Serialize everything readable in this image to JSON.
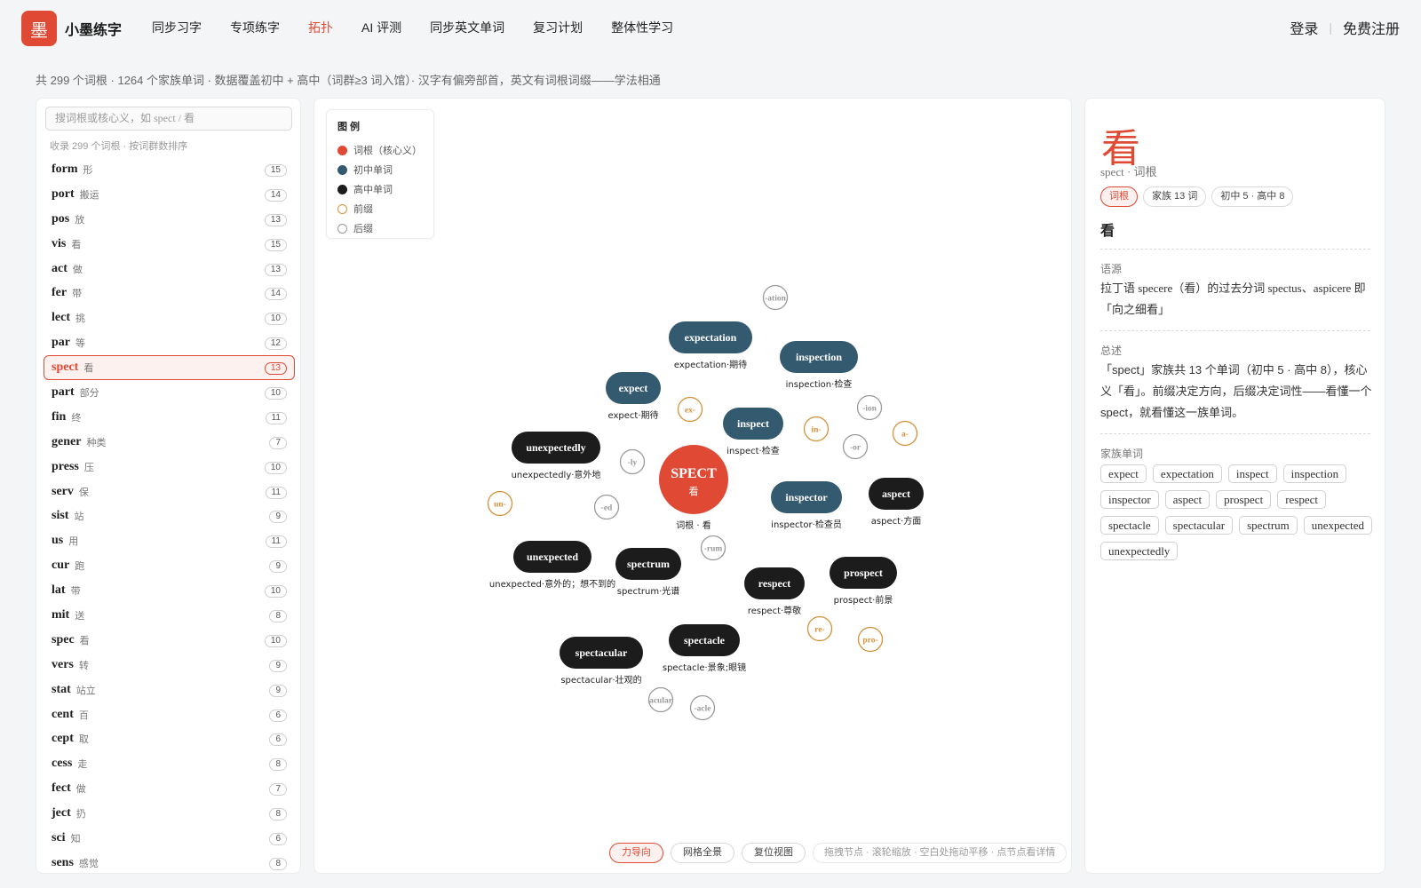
{
  "header": {
    "logo_char": "墨",
    "brand": "小墨练字",
    "nav": [
      "同步习字",
      "专项练字",
      "拓扑",
      "AI 评测",
      "同步英文单词",
      "复习计划",
      "整体性学习"
    ],
    "active_nav": "拓扑",
    "login": "登录",
    "separator": "|",
    "register": "免费注册"
  },
  "subline": "共 299 个词根 · 1264 个家族单词 · 数据覆盖初中 + 高中（词群≥3 词入馆）· 汉字有偏旁部首，英文有词根词缀——学法相通",
  "sidebar": {
    "search_placeholder": "搜词根或核心义，如 spect / 看",
    "count_note": "收录 299 个词根 · 按词群数排序",
    "roots": [
      {
        "name": "form",
        "meaning": "形",
        "count": "15"
      },
      {
        "name": "port",
        "meaning": "搬运",
        "count": "14"
      },
      {
        "name": "pos",
        "meaning": "放",
        "count": "13"
      },
      {
        "name": "vis",
        "meaning": "看",
        "count": "15"
      },
      {
        "name": "act",
        "meaning": "做",
        "count": "13"
      },
      {
        "name": "fer",
        "meaning": "带",
        "count": "14"
      },
      {
        "name": "lect",
        "meaning": "挑",
        "count": "10"
      },
      {
        "name": "par",
        "meaning": "等",
        "count": "12"
      },
      {
        "name": "spect",
        "meaning": "看",
        "count": "13",
        "active": true
      },
      {
        "name": "part",
        "meaning": "部分",
        "count": "10"
      },
      {
        "name": "fin",
        "meaning": "终",
        "count": "11"
      },
      {
        "name": "gener",
        "meaning": "种类",
        "count": "7"
      },
      {
        "name": "press",
        "meaning": "压",
        "count": "10"
      },
      {
        "name": "serv",
        "meaning": "保",
        "count": "11"
      },
      {
        "name": "sist",
        "meaning": "站",
        "count": "9"
      },
      {
        "name": "us",
        "meaning": "用",
        "count": "11"
      },
      {
        "name": "cur",
        "meaning": "跑",
        "count": "9"
      },
      {
        "name": "lat",
        "meaning": "带",
        "count": "10"
      },
      {
        "name": "mit",
        "meaning": "送",
        "count": "8"
      },
      {
        "name": "spec",
        "meaning": "看",
        "count": "10"
      },
      {
        "name": "vers",
        "meaning": "转",
        "count": "9"
      },
      {
        "name": "stat",
        "meaning": "站立",
        "count": "9"
      },
      {
        "name": "cent",
        "meaning": "百",
        "count": "6"
      },
      {
        "name": "cept",
        "meaning": "取",
        "count": "6"
      },
      {
        "name": "cess",
        "meaning": "走",
        "count": "8"
      },
      {
        "name": "fect",
        "meaning": "做",
        "count": "7"
      },
      {
        "name": "ject",
        "meaning": "扔",
        "count": "8"
      },
      {
        "name": "sci",
        "meaning": "知",
        "count": "6"
      },
      {
        "name": "sens",
        "meaning": "感觉",
        "count": "8"
      }
    ]
  },
  "legend": {
    "title": "图 例",
    "items": [
      {
        "label": "词根（核心义）",
        "color": "#e04a35",
        "style": "fill"
      },
      {
        "label": "初中单词",
        "color": "#345a70",
        "style": "fill"
      },
      {
        "label": "高中单词",
        "color": "#1c1c1c",
        "style": "fill"
      },
      {
        "label": "前缀",
        "color": "#d4913a",
        "style": "ring"
      },
      {
        "label": "后缀",
        "color": "#9a9a9a",
        "style": "ring"
      }
    ]
  },
  "graph": {
    "root": {
      "word": "SPECT",
      "meaning": "看",
      "caption": "词根 · 看"
    },
    "words": [
      {
        "word": "expectation",
        "caption": "expectation·期待",
        "level": "middle"
      },
      {
        "word": "inspection",
        "caption": "inspection·检查",
        "level": "middle"
      },
      {
        "word": "expect",
        "caption": "expect·期待",
        "level": "middle"
      },
      {
        "word": "inspect",
        "caption": "inspect·检查",
        "level": "middle"
      },
      {
        "word": "unexpectedly",
        "caption": "unexpectedly·意外地",
        "level": "high"
      },
      {
        "word": "inspector",
        "caption": "inspector·检查员",
        "level": "middle"
      },
      {
        "word": "aspect",
        "caption": "aspect·方面",
        "level": "high"
      },
      {
        "word": "unexpected",
        "caption": "unexpected·意外的；想不到的",
        "level": "high"
      },
      {
        "word": "spectrum",
        "caption": "spectrum·光谱",
        "level": "high"
      },
      {
        "word": "respect",
        "caption": "respect·尊敬",
        "level": "high"
      },
      {
        "word": "prospect",
        "caption": "prospect·前景",
        "level": "high"
      },
      {
        "word": "spectacular",
        "caption": "spectacular·壮观的",
        "level": "high"
      },
      {
        "word": "spectacle",
        "caption": "spectacle·景象;眼镜",
        "level": "high"
      }
    ],
    "prefixes": [
      "ex-",
      "in-",
      "a-",
      "un-",
      "re-",
      "pro-"
    ],
    "suffixes": [
      "-ation",
      "-ion",
      "-or",
      "-ly",
      "-ed",
      "-rum",
      "acular",
      "-acle"
    ]
  },
  "toolbar": {
    "force": "力导向",
    "grid": "网格全景",
    "reset": "复位视图",
    "hint": "拖拽节点 · 滚轮缩放 · 空白处拖动平移 · 点节点看详情"
  },
  "detail": {
    "char": "看",
    "meta": "spect · 词根",
    "tags": [
      "词根",
      "家族 13 词",
      "初中 5 · 高中 8"
    ],
    "meaning": "看",
    "etym_title": "语源",
    "etym_body": "拉丁语 specere（看）的过去分词 spectus、aspicere 即「向之细看」",
    "summary_title": "总述",
    "summary_body": "「spect」家族共 13 个单词（初中 5 · 高中 8），核心义「看」。前缀决定方向，后缀决定词性——看懂一个 spect，就看懂这一族单词。",
    "family_title": "家族单词",
    "family": [
      "expect",
      "expectation",
      "inspect",
      "inspection",
      "inspector",
      "aspect",
      "prospect",
      "respect",
      "spectacle",
      "spectacular",
      "spectrum",
      "unexpected",
      "unexpectedly"
    ]
  },
  "colors": {
    "accent": "#e04a35",
    "middle_word": "#345a70",
    "high_word": "#1c1c1c",
    "prefix": "#d4913a",
    "suffix": "#9a9a9a"
  }
}
